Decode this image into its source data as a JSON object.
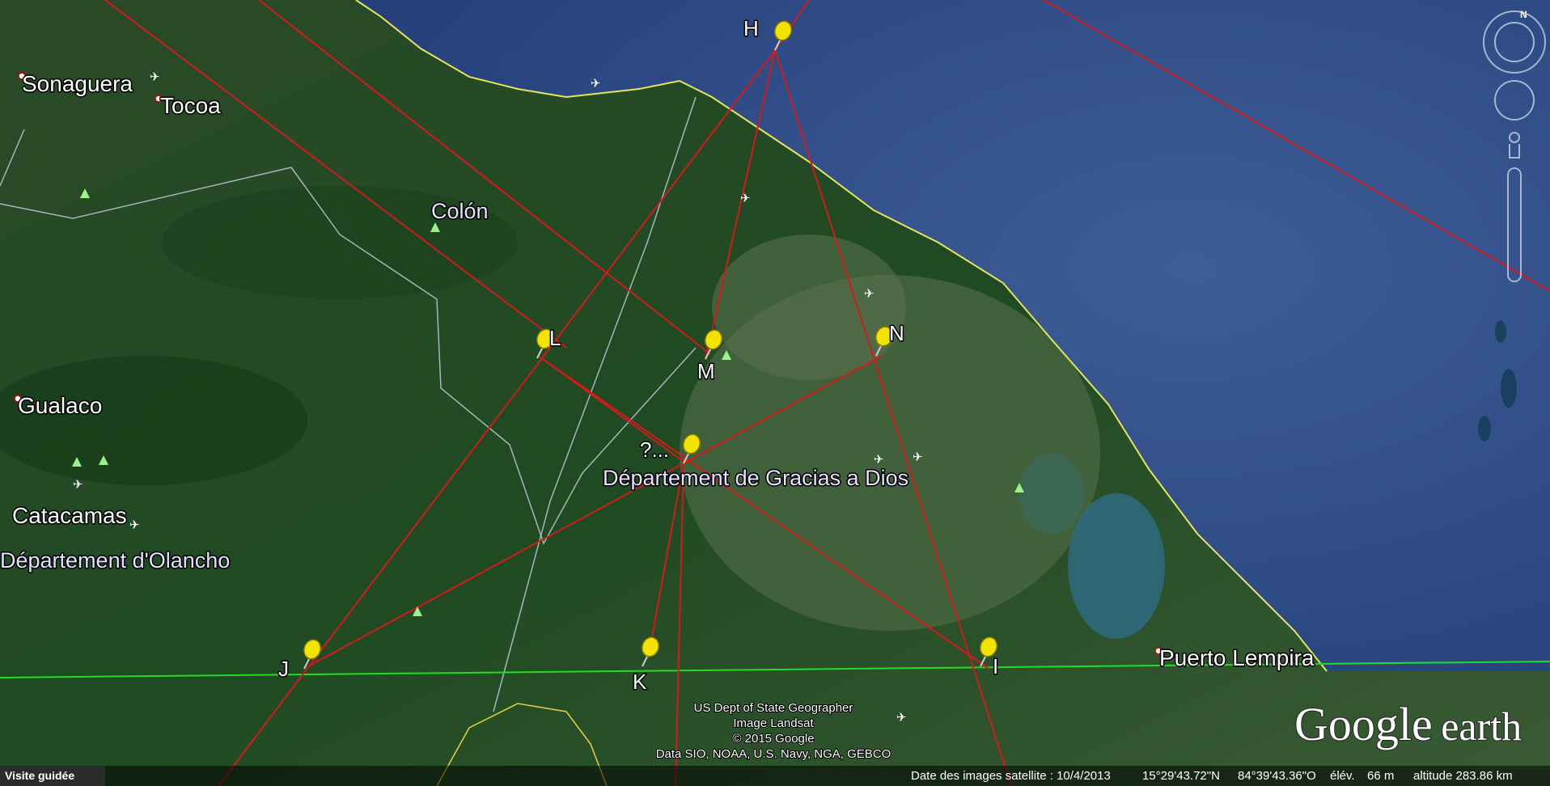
{
  "places": [
    {
      "name": "Sonaguera"
    },
    {
      "name": "Tocoa"
    },
    {
      "name": "Colón"
    },
    {
      "name": "Gualaco"
    },
    {
      "name": "Catacamas"
    },
    {
      "name": "Puerto Lempira"
    }
  ],
  "regions": [
    {
      "name": "Département de Gracias a Dios"
    },
    {
      "name": "Département d'Olancho"
    }
  ],
  "pins": [
    {
      "label": "H"
    },
    {
      "label": "L"
    },
    {
      "label": "M"
    },
    {
      "label": "N"
    },
    {
      "label": "?..."
    },
    {
      "label": "J"
    },
    {
      "label": "K"
    },
    {
      "label": "I"
    }
  ],
  "credits": [
    "US Dept of State Geographer",
    "Image Landsat",
    "© 2015 Google",
    "Data SIO, NOAA, U.S. Navy, NGA, GEBCO"
  ],
  "logo": {
    "google": "Google",
    "earth": "earth"
  },
  "compass": {
    "north": "N"
  },
  "status": {
    "tour": "Visite guidée",
    "date": "Date des images satellite : 10/4/2013",
    "lat": "15°29'43.72\"N",
    "lon": "84°39'43.36\"O",
    "elev_label": "élév.",
    "elev": "66 m",
    "altitude": "altitude 283.86 km"
  },
  "colors": {
    "lines": "#d41a1a",
    "border": "#22dd22",
    "pin": "#f2e400",
    "coast": "#e5e55a"
  }
}
